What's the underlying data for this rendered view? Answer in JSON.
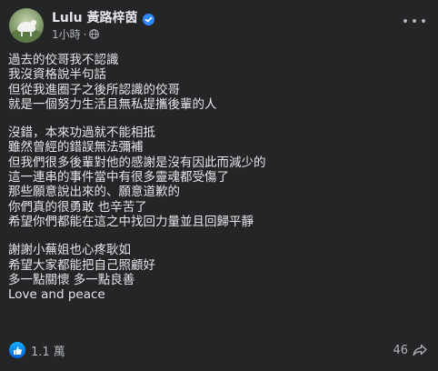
{
  "post": {
    "author": "Lulu 黃路梓茵",
    "time": "1小時",
    "separator": "·",
    "paragraphs": [
      [
        "過去的佼哥我不認識",
        "我沒資格說半句話",
        "但從我進圈子之後所認識的佼哥",
        "就是一個努力生活且無私提攜後輩的人"
      ],
      [
        "沒錯，本來功過就不能相抵",
        "雖然曾經的錯誤無法彌補",
        "但我們很多後輩對他的感謝是沒有因此而減少的",
        "這一連串的事件當中有很多靈魂都受傷了",
        "那些願意說出來的、願意道歉的",
        "你們真的很勇敢 也辛苦了",
        "希望你們都能在這之中找回力量並且回歸平靜"
      ],
      [
        "謝謝小蕪姐也心疼耿如",
        "希望大家都能把自己照顧好",
        "多一點關懷 多一點良善",
        "Love and peace"
      ]
    ],
    "reactions": "1.1 萬",
    "shares": "46"
  },
  "icons": {
    "verified": "verified-badge-icon",
    "audience": "globe-icon",
    "more": "more-options-icon",
    "like": "like-icon",
    "share": "share-arrow-icon"
  },
  "colors": {
    "background": "#242526",
    "text": "#e4e6eb",
    "secondary_text": "#b0b3b8",
    "accent": "#2d88ff"
  }
}
